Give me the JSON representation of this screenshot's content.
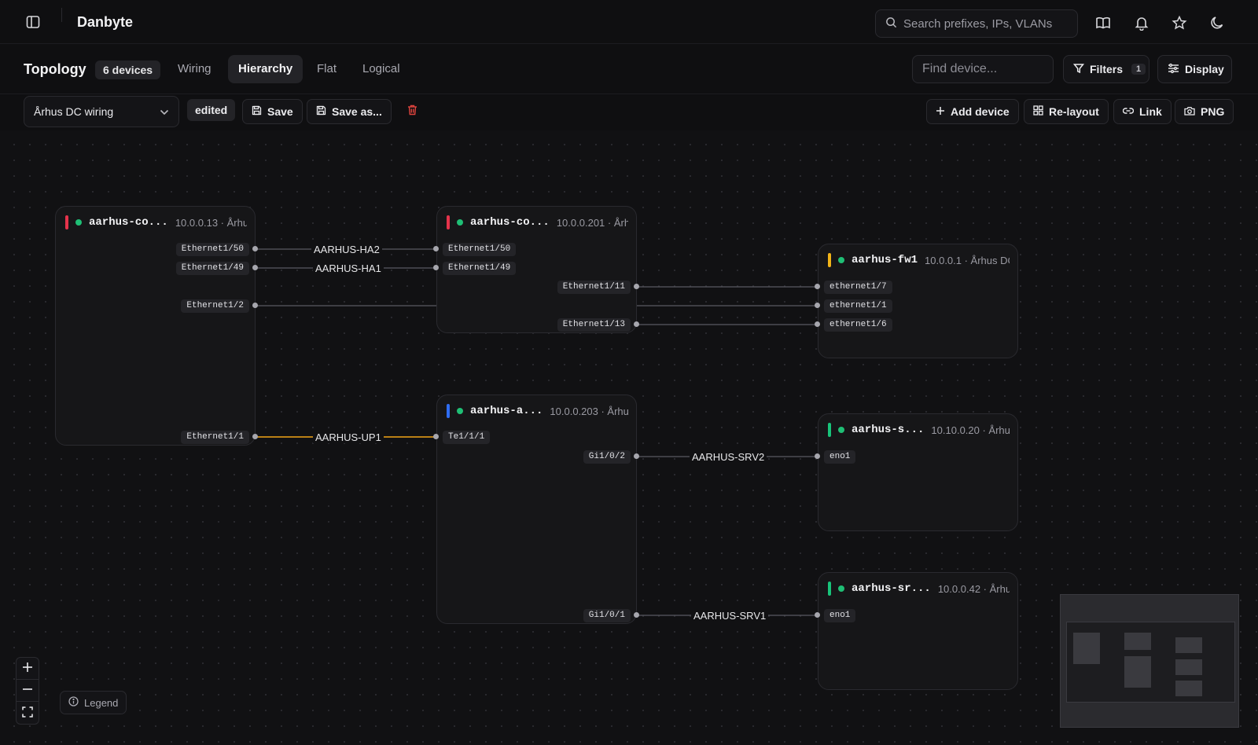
{
  "app": {
    "title": "Danbyte"
  },
  "search": {
    "placeholder": "Search prefixes, IPs, VLANs"
  },
  "topology": {
    "title": "Topology",
    "device_count": "6 devices",
    "tabs": [
      {
        "label": "Wiring",
        "active": false
      },
      {
        "label": "Hierarchy",
        "active": true
      },
      {
        "label": "Flat",
        "active": false
      },
      {
        "label": "Logical",
        "active": false
      }
    ],
    "find_placeholder": "Find device...",
    "filters_label": "Filters",
    "filters_count": "1",
    "display_label": "Display"
  },
  "layout_bar": {
    "selected_layout": "Århus DC wiring",
    "edited_badge": "edited",
    "save_label": "Save",
    "save_as_label": "Save as...",
    "add_device_label": "Add device",
    "relayout_label": "Re-layout",
    "link_label": "Link",
    "png_label": "PNG"
  },
  "colors": {
    "red": "#e5334b",
    "yellow": "#f2b418",
    "blue": "#2f6df2",
    "green": "#18c47a",
    "online": "#1fbf75",
    "uplink": "#f2a516"
  },
  "devices": [
    {
      "name": "aarhus-co...",
      "meta": "10.0.0.13 · Århu...",
      "stripe": "red",
      "ports": [
        "Ethernet1/50",
        "Ethernet1/49",
        "Ethernet1/2",
        "Ethernet1/1"
      ]
    },
    {
      "name": "aarhus-co...",
      "meta": "10.0.0.201 · Århu...",
      "stripe": "red",
      "ports": [
        "Ethernet1/50",
        "Ethernet1/49",
        "Ethernet1/11",
        "Ethernet1/13"
      ]
    },
    {
      "name": "aarhus-fw1",
      "meta": "10.0.0.1 · Århus DC",
      "stripe": "yellow",
      "ports": [
        "ethernet1/7",
        "ethernet1/1",
        "ethernet1/6"
      ]
    },
    {
      "name": "aarhus-a...",
      "meta": "10.0.0.203 · Århu...",
      "stripe": "blue",
      "ports": [
        "Te1/1/1",
        "Gi1/0/2",
        "Gi1/0/1"
      ]
    },
    {
      "name": "aarhus-s...",
      "meta": "10.10.0.20 · Århu...",
      "stripe": "green",
      "ports": [
        "eno1"
      ]
    },
    {
      "name": "aarhus-sr...",
      "meta": "10.0.0.42 · Århus...",
      "stripe": "green",
      "ports": [
        "eno1"
      ]
    }
  ],
  "links": [
    {
      "label": "AARHUS-HA2"
    },
    {
      "label": "AARHUS-HA1"
    },
    {
      "label": "AARHUS-UP1",
      "uplink": true
    },
    {
      "label": "AARHUS-SRV2"
    },
    {
      "label": "AARHUS-SRV1"
    }
  ],
  "legend": {
    "label": "Legend"
  }
}
